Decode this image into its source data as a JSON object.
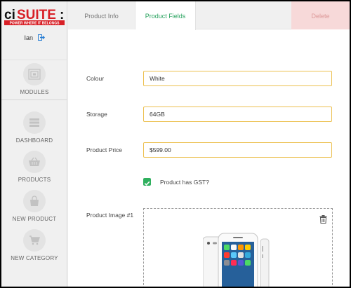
{
  "brand": {
    "logo_text": "ciSUITE:",
    "tagline": "POWER WHERE IT BELONGS"
  },
  "user": {
    "name": "Ian",
    "logout_icon": "logout-icon"
  },
  "sidebar": {
    "items": [
      {
        "label": "MODULES",
        "icon": "modules-icon"
      },
      {
        "label": "DASHBOARD",
        "icon": "dashboard-icon"
      },
      {
        "label": "PRODUCTS",
        "icon": "basket-icon"
      },
      {
        "label": "NEW PRODUCT",
        "icon": "bag-icon"
      },
      {
        "label": "NEW CATEGORY",
        "icon": "cart-icon"
      }
    ]
  },
  "tabs": {
    "product_info": "Product Info",
    "product_fields": "Product Fields",
    "delete": "Delete"
  },
  "form": {
    "colour_label": "Colour",
    "colour_value": "White",
    "storage_label": "Storage",
    "storage_value": "64GB",
    "price_label": "Product Price",
    "price_value": "$599.00",
    "gst_label": "Product has GST?",
    "gst_checked": true,
    "image_label": "Product Image #1"
  },
  "colors": {
    "accent_green": "#29a35f",
    "input_border": "#ecc04f",
    "delete_bg": "#f7d9d9"
  }
}
